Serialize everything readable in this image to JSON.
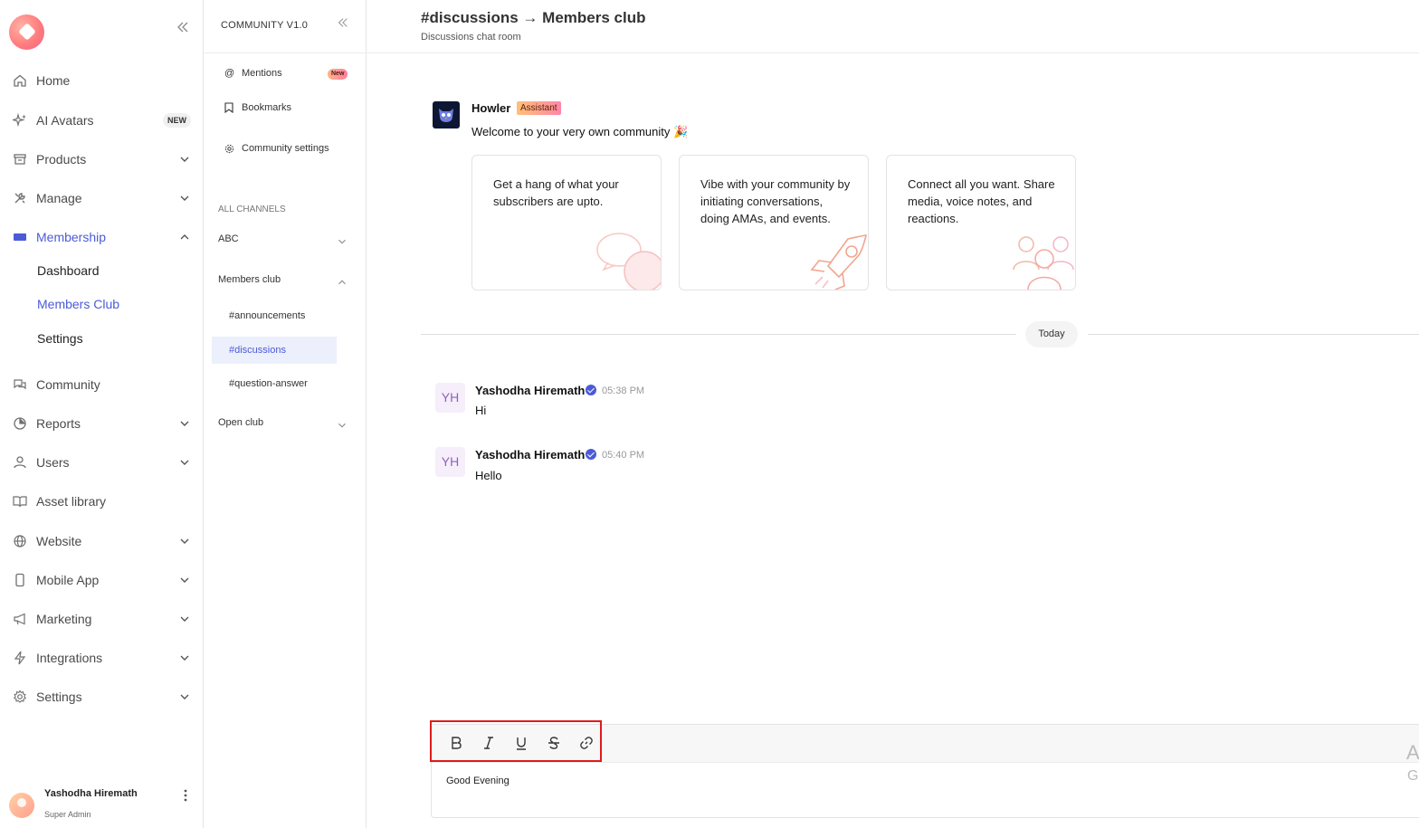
{
  "sidebar": {
    "items": [
      {
        "label": "Home"
      },
      {
        "label": "AI Avatars",
        "badge": "NEW"
      },
      {
        "label": "Products"
      },
      {
        "label": "Manage"
      },
      {
        "label": "Membership"
      },
      {
        "label": "Community"
      },
      {
        "label": "Reports"
      },
      {
        "label": "Users"
      },
      {
        "label": "Asset library"
      },
      {
        "label": "Website"
      },
      {
        "label": "Mobile App"
      },
      {
        "label": "Marketing"
      },
      {
        "label": "Integrations"
      },
      {
        "label": "Settings"
      }
    ],
    "membership_sub": [
      "Dashboard",
      "Members Club",
      "Settings"
    ],
    "active_item": "Membership",
    "active_sub": "Members Club",
    "user": {
      "name": "Yashodha Hiremath",
      "role": "Super Admin"
    },
    "accent_color": "#4b5bd8"
  },
  "community_panel": {
    "title": "COMMUNITY V1.0",
    "mentions_label": "Mentions",
    "mentions_badge": "New",
    "bookmarks_label": "Bookmarks",
    "settings_label": "Community settings",
    "all_channels_label": "ALL CHANNELS",
    "groups": [
      {
        "name": "ABC",
        "expanded": false
      },
      {
        "name": "Members club",
        "expanded": true,
        "channels": [
          "#announcements",
          "#discussions",
          "#question-answer"
        ]
      },
      {
        "name": "Open club",
        "expanded": false
      }
    ],
    "active_channel": "#discussions"
  },
  "main": {
    "title": "#discussions → Members club",
    "subtitle": "Discussions chat room",
    "bot": {
      "name": "Howler",
      "badge": "Assistant",
      "message": "Welcome to your very own community 🎉"
    },
    "cards": [
      {
        "text": "Get a hang of what your subscribers are upto.",
        "icon": "chat-bubbles-icon"
      },
      {
        "text": "Vibe with your community by initiating conversations, doing AMAs, and events.",
        "icon": "rocket-icon"
      },
      {
        "text": "Connect all you want. Share media, voice notes, and reactions.",
        "icon": "people-icon"
      }
    ],
    "date_divider": "Today",
    "messages": [
      {
        "initials": "YH",
        "author": "Yashodha Hiremath",
        "time": "05:38 PM",
        "text": "Hi"
      },
      {
        "initials": "YH",
        "author": "Yashodha Hiremath",
        "time": "05:40 PM",
        "text": "Hello"
      }
    ],
    "composer": {
      "toolbar": [
        {
          "label": "B",
          "name": "bold"
        },
        {
          "label": "I",
          "name": "italic"
        },
        {
          "label": "U",
          "name": "underline"
        },
        {
          "label": "S",
          "name": "strikethrough"
        },
        {
          "label": "link",
          "name": "link"
        }
      ],
      "value": "Good Evening",
      "side_a": "A",
      "side_b": "G"
    }
  }
}
